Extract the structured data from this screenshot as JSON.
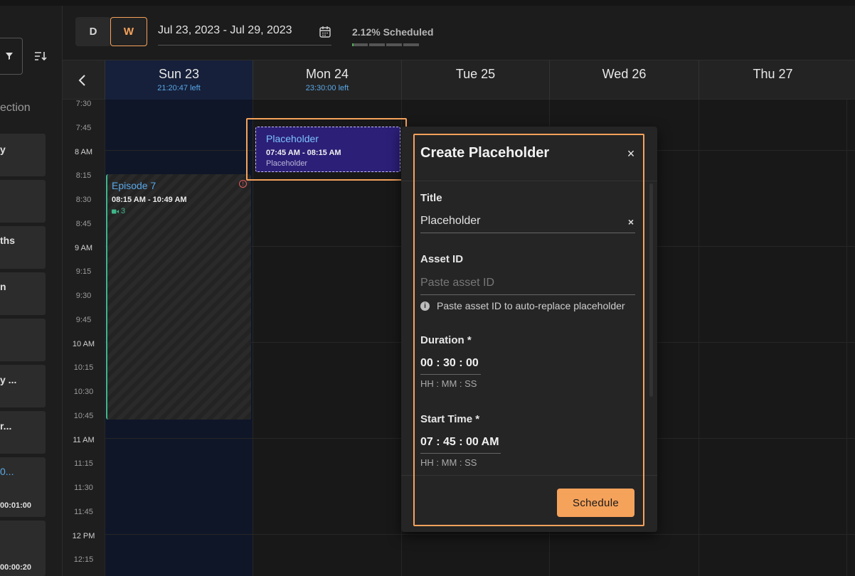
{
  "sidebar": {
    "section_label": "ection",
    "cards": [
      "y",
      "",
      "ths",
      "n",
      "",
      "y ...",
      "r...",
      "0...",
      "00:01:00",
      "00:00:20"
    ]
  },
  "header": {
    "view_day": "D",
    "view_week": "W",
    "date_range": "Jul 23, 2023 - Jul 29, 2023",
    "scheduled": "2.12% Scheduled"
  },
  "days": [
    {
      "name": "Sun 23",
      "left": "21:20:47 left"
    },
    {
      "name": "Mon 24",
      "left": "23:30:00 left"
    },
    {
      "name": "Tue 25",
      "left": ""
    },
    {
      "name": "Wed 26",
      "left": ""
    },
    {
      "name": "Thu 27",
      "left": ""
    }
  ],
  "times": [
    "7:30",
    "7:45",
    "8 AM",
    "8:15",
    "8:30",
    "8:45",
    "9 AM",
    "9:15",
    "9:30",
    "9:45",
    "10 AM",
    "10:15",
    "10:30",
    "10:45",
    "11 AM",
    "11:15",
    "11:30",
    "11:45",
    "12 PM",
    "12:15"
  ],
  "events": {
    "episode": {
      "title": "Episode 7",
      "time": "08:15 AM - 10:49 AM",
      "count": "3",
      "warn": "!"
    },
    "placeholder": {
      "title": "Placeholder",
      "time": "07:45 AM - 08:15 AM",
      "subtitle": "Placeholder"
    }
  },
  "dialog": {
    "title": "Create Placeholder",
    "close": "×",
    "title_label": "Title",
    "title_value": "Placeholder",
    "clear": "×",
    "asset_label": "Asset ID",
    "asset_placeholder": "Paste asset ID",
    "asset_hint": "Paste asset ID to auto-replace placeholder",
    "info": "i",
    "duration_label": "Duration *",
    "duration_value": "00 : 30 : 00",
    "duration_format": "HH : MM : SS",
    "start_label": "Start Time *",
    "start_value": "07 : 45 : 00 AM",
    "start_format": "HH : MM : SS",
    "schedule_button": "Schedule"
  },
  "colors": {
    "accent": "#f5a25b",
    "placeholder_bg": "#2c1f78",
    "episode_border": "#3fb68a",
    "link_blue": "#5aa8e8"
  }
}
